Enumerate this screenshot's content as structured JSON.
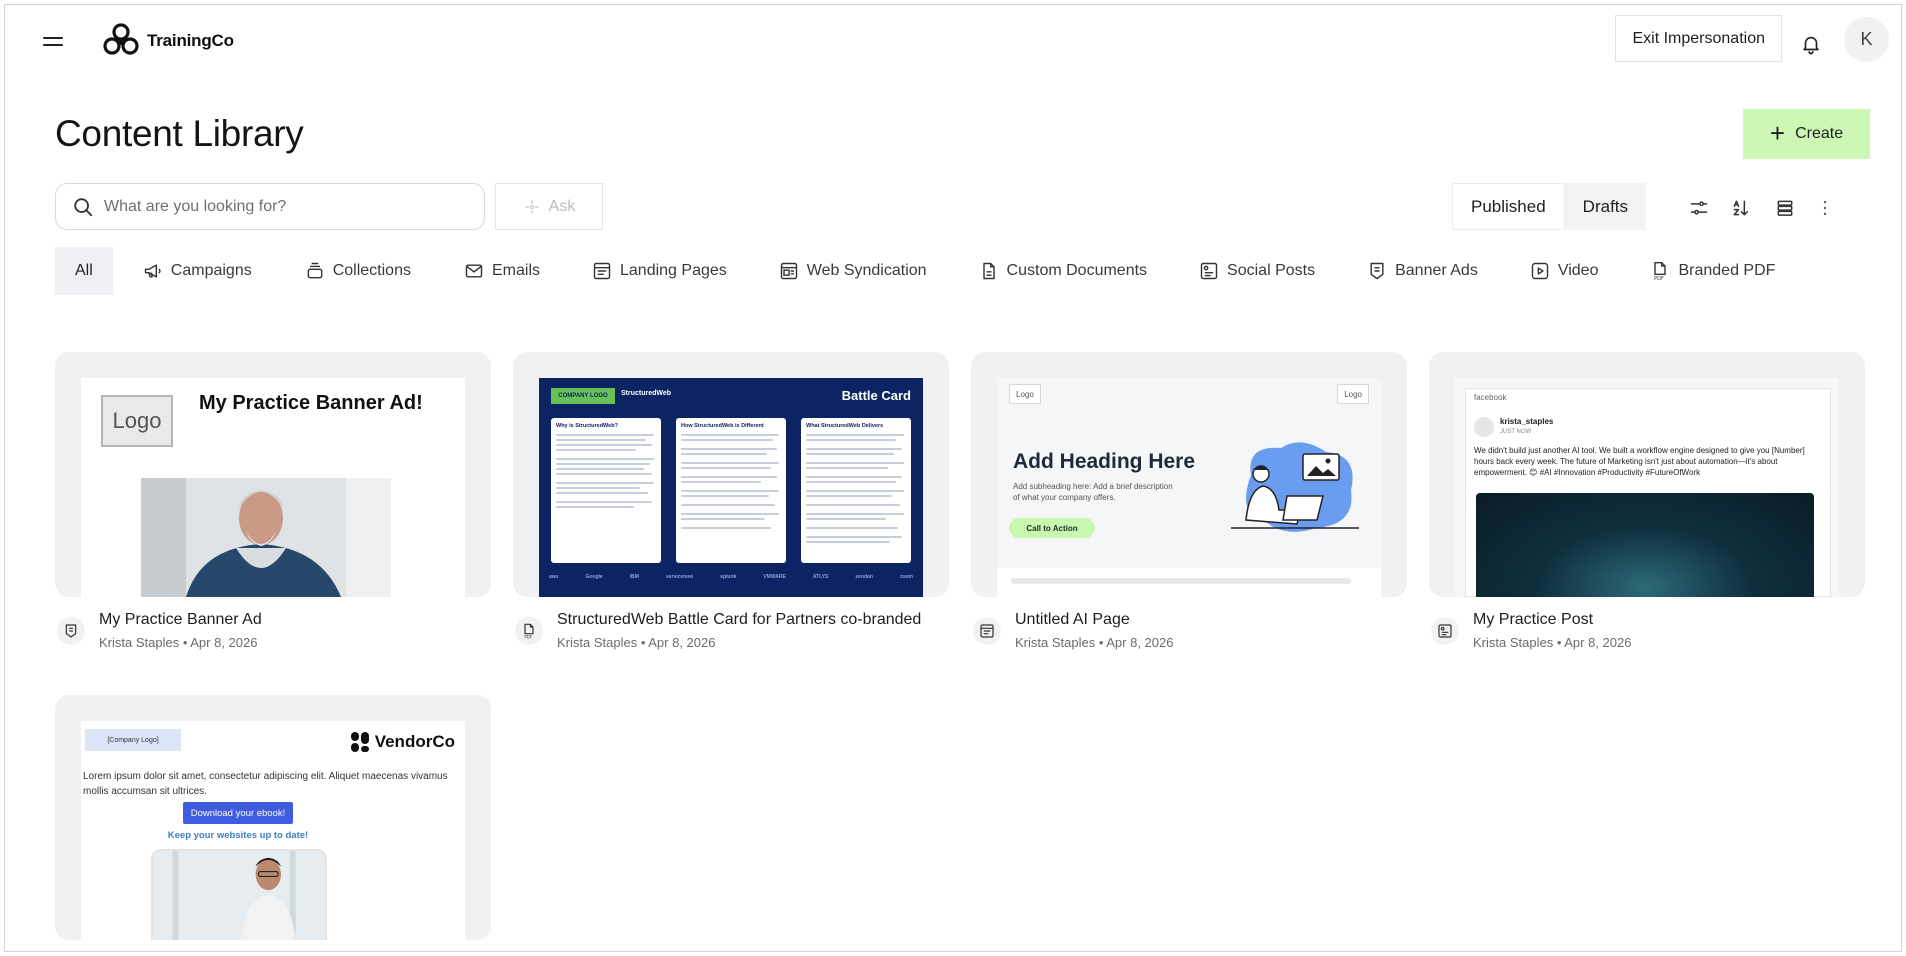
{
  "app": {
    "name": "TrainingCo"
  },
  "header": {
    "exit_impersonation": "Exit Impersonation",
    "avatar_initial": "K",
    "menu_icon": "hamburger-menu-icon",
    "bell_icon": "bell-icon"
  },
  "page": {
    "title": "Content Library",
    "create_label": "Create"
  },
  "search": {
    "placeholder": "What are you looking for?",
    "ask_label": "Ask"
  },
  "view_toggle": {
    "published": "Published",
    "drafts": "Drafts",
    "selected": "Published"
  },
  "toolbar_icons": [
    "filter-icon",
    "sort-icon",
    "list-view-icon",
    "more-icon"
  ],
  "tabs": [
    {
      "label": "All",
      "icon": "",
      "active": true
    },
    {
      "label": "Campaigns",
      "icon": "megaphone-icon"
    },
    {
      "label": "Collections",
      "icon": "collection-icon"
    },
    {
      "label": "Emails",
      "icon": "envelope-icon"
    },
    {
      "label": "Landing Pages",
      "icon": "landing-page-icon"
    },
    {
      "label": "Web Syndication",
      "icon": "web-syndication-icon"
    },
    {
      "label": "Custom Documents",
      "icon": "document-icon"
    },
    {
      "label": "Social Posts",
      "icon": "social-post-icon"
    },
    {
      "label": "Banner Ads",
      "icon": "banner-ad-icon"
    },
    {
      "label": "Video",
      "icon": "video-icon"
    },
    {
      "label": "Branded PDF",
      "icon": "pdf-icon"
    }
  ],
  "cards": [
    {
      "title": "My Practice Banner Ad",
      "author": "Krista Staples",
      "date": "Apr 8, 2026",
      "type_icon": "banner-ad-icon",
      "preview": {
        "logo": "Logo",
        "headline": "My Practice Banner Ad!"
      }
    },
    {
      "title": "StructuredWeb Battle Card for Partners co-branded",
      "author": "Krista Staples",
      "date": "Apr 8, 2026",
      "type_icon": "pdf-icon",
      "preview": {
        "logo": "COMPANY LOGO",
        "brand": "StructuredWeb",
        "headline": "Battle Card",
        "columns": [
          "Why is StructuredWeb?",
          "How StructuredWeb is Different",
          "What StructuredWeb Delivers"
        ],
        "partners": [
          "aws",
          "Google",
          "IBM",
          "servicenow",
          "splunk",
          "VMWARE",
          "ATLYS",
          "sendan",
          "zoom"
        ]
      }
    },
    {
      "title": "Untitled AI Page",
      "author": "Krista Staples",
      "date": "Apr 8, 2026",
      "type_icon": "landing-page-icon",
      "preview": {
        "logo_left": "Logo",
        "logo_right": "Logo",
        "headline": "Add Heading Here",
        "subheading": "Add subheading here: Add a brief description of what your company offers.",
        "cta": "Call to Action"
      }
    },
    {
      "title": "My Practice Post",
      "author": "Krista Staples",
      "date": "Apr 8, 2026",
      "type_icon": "social-post-icon",
      "preview": {
        "network": "facebook",
        "user": "krista_staples",
        "time": "JUST NOW",
        "text": "We didn't build just another AI tool. We built a workflow engine designed to give you [Number] hours back every week. The future of Marketing isn't just about automation—it's about empowerment. 😊 #AI #Innovation #Productivity #FutureOfWork"
      }
    },
    {
      "title": "",
      "author": "",
      "date": "",
      "type_icon": "envelope-icon",
      "preview": {
        "logo": "[Company Logo]",
        "brand": "VendorCo",
        "body": "Lorem ipsum dolor sit amet, consectetur adipiscing elit. Aliquet maecenas vivamus mollis accumsan sit ultrices.",
        "button": "Download your ebook!",
        "link": "Keep your websites up to date!"
      }
    }
  ],
  "colors": {
    "create_button": "#ccf7b4",
    "active_tab": "#eef0f3",
    "battle_card_bg": "#0c2463",
    "email_button": "#3d5ce0"
  }
}
